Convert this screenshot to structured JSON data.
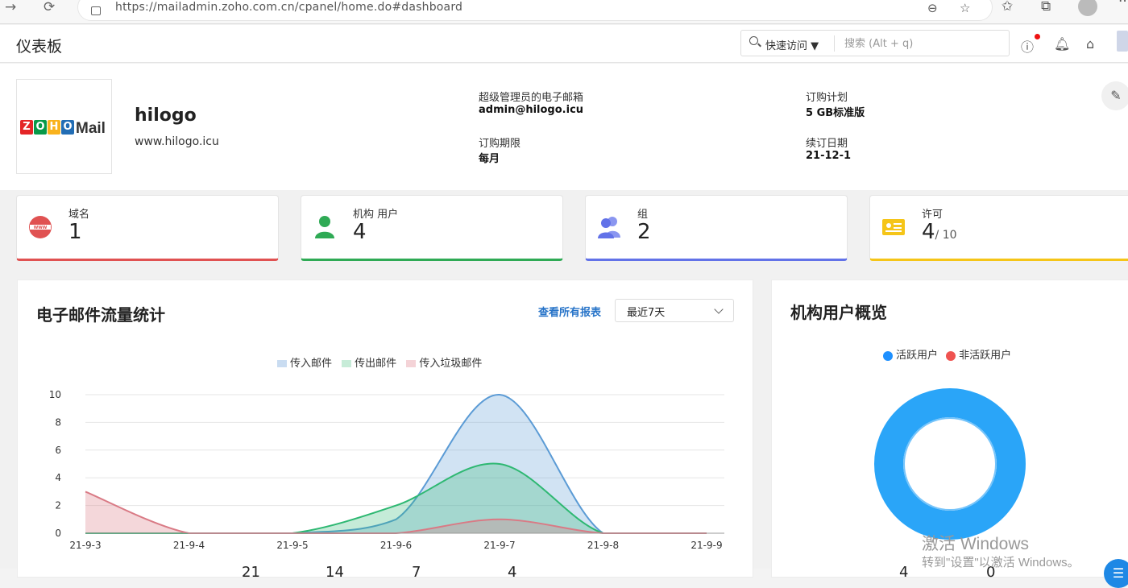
{
  "browser": {
    "url": "https://mailadmin.zoho.com.cn/cpanel/home.do#dashboard"
  },
  "header": {
    "title": "仪表板",
    "quick_access": "快速访问 ▼",
    "search_placeholder": "搜索 (Alt + q)"
  },
  "profile": {
    "org_name": "hilogo",
    "website": "www.hilogo.icu",
    "logo_text": "ZOHO",
    "logo_mail": "Mail",
    "fields": [
      {
        "label": "超级管理员的电子邮箱",
        "value": "admin@hilogo.icu"
      },
      {
        "label": "订购期限",
        "value": "每月"
      },
      {
        "label": "订购计划",
        "value": "5 GB标准版"
      },
      {
        "label": "续订日期",
        "value": "21-12-1"
      }
    ]
  },
  "cards": [
    {
      "label": "域名",
      "value": "1",
      "color": "#e05252"
    },
    {
      "label": "机构 用户",
      "value": "4",
      "color": "#2faa55"
    },
    {
      "label": "组",
      "value": "2",
      "color": "#6272e8"
    },
    {
      "label": "许可",
      "value": "4",
      "sub": "/ 10",
      "color": "#f5c518"
    }
  ],
  "traffic": {
    "title": "电子邮件流量统计",
    "view_all": "查看所有报表",
    "range": "最近7天",
    "bottom_numbers": [
      "21",
      "14",
      "7",
      "4"
    ]
  },
  "chart_data": {
    "type": "area",
    "x": [
      "21-9-3",
      "21-9-4",
      "21-9-5",
      "21-9-6",
      "21-9-7",
      "21-9-8",
      "21-9-9"
    ],
    "ylim": [
      0,
      10
    ],
    "yticks": [
      "0",
      "2",
      "4",
      "6",
      "8",
      "10"
    ],
    "series": [
      {
        "name": "传入邮件",
        "values": [
          0,
          0,
          0,
          1,
          10,
          0,
          0
        ],
        "color": "#5b9bd5"
      },
      {
        "name": "传出邮件",
        "values": [
          0,
          0,
          0,
          2,
          5,
          0,
          0
        ],
        "color": "#2eb872"
      },
      {
        "name": "传入垃圾邮件",
        "values": [
          3,
          0,
          0,
          0,
          1,
          0,
          0
        ],
        "color": "#d97a85"
      }
    ]
  },
  "users": {
    "title": "机构用户概览",
    "legend": [
      {
        "name": "活跃用户",
        "color": "#1e90ff"
      },
      {
        "name": "非活跃用户",
        "color": "#ef5350"
      }
    ],
    "active": 4,
    "inactive": 0,
    "numbers": [
      "4",
      "0"
    ]
  },
  "watermark": {
    "line1": "激活 Windows",
    "line2": "转到\"设置\"以激活 Windows。"
  }
}
